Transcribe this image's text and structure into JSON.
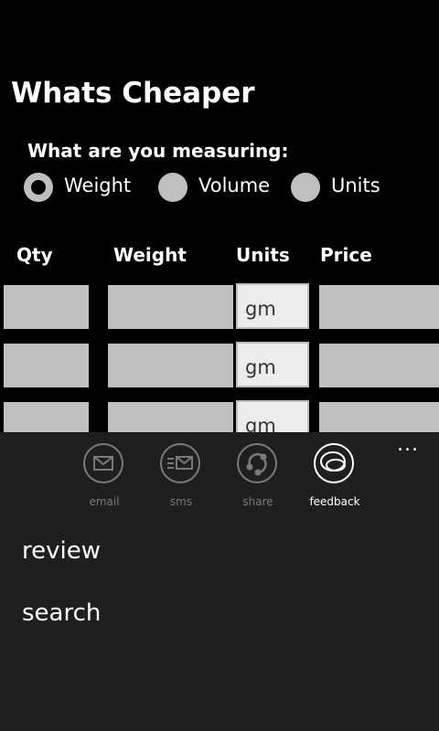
{
  "app": {
    "title": "Whats Cheaper"
  },
  "measure": {
    "question": "What are you measuring:",
    "options": [
      {
        "label": "Weight",
        "selected": true
      },
      {
        "label": "Volume",
        "selected": false
      },
      {
        "label": "Units",
        "selected": false
      }
    ]
  },
  "table": {
    "headers": [
      "Qty",
      "Weight",
      "Units",
      "Price"
    ],
    "rows": [
      {
        "qty": "",
        "weight": "",
        "units": "gm",
        "price": ""
      },
      {
        "qty": "",
        "weight": "",
        "units": "gm",
        "price": ""
      },
      {
        "qty": "",
        "weight": "",
        "units": "gm",
        "price": ""
      }
    ]
  },
  "appbar": {
    "more_label": "...",
    "buttons": [
      {
        "label": "email",
        "icon": "email-icon"
      },
      {
        "label": "sms",
        "icon": "sms-icon"
      },
      {
        "label": "share",
        "icon": "share-icon"
      },
      {
        "label": "feedback",
        "icon": "feedback-icon",
        "active": true
      }
    ],
    "menu": [
      {
        "label": "review"
      },
      {
        "label": "search"
      }
    ]
  },
  "colors": {
    "background": "#000000",
    "appbar": "#1f1f1f",
    "field": "#bfbfbf",
    "text": "#ffffff",
    "inactive": "#7a7a7a"
  }
}
